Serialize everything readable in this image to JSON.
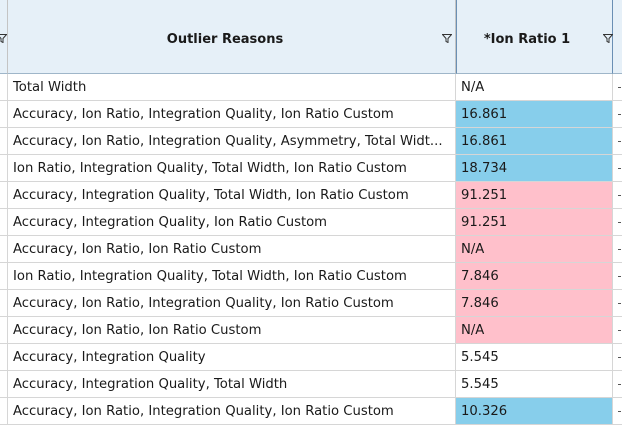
{
  "columns": {
    "outlier_reasons": "Outlier Reasons",
    "ion_ratio_1": "*Ion Ratio 1"
  },
  "colors": {
    "header_bg": "#e6f0f8",
    "blue_highlight": "#87ceeb",
    "pink_highlight": "#ffc0cb",
    "gridline": "#d6d6d6"
  },
  "icons": {
    "filter": "filter-icon"
  },
  "rows": [
    {
      "reason": "Total Width",
      "ion": "N/A",
      "highlight": "none"
    },
    {
      "reason": "Accuracy, Ion Ratio, Integration Quality, Ion Ratio Custom",
      "ion": "16.861",
      "highlight": "blue"
    },
    {
      "reason": "Accuracy, Ion Ratio, Integration Quality, Asymmetry, Total Widt...",
      "ion": "16.861",
      "highlight": "blue"
    },
    {
      "reason": "Ion Ratio, Integration Quality, Total Width, Ion Ratio Custom",
      "ion": "18.734",
      "highlight": "blue"
    },
    {
      "reason": "Accuracy, Integration Quality, Total Width, Ion Ratio Custom",
      "ion": "91.251",
      "highlight": "pink"
    },
    {
      "reason": "Accuracy, Integration Quality, Ion Ratio Custom",
      "ion": "91.251",
      "highlight": "pink"
    },
    {
      "reason": "Accuracy, Ion Ratio, Ion Ratio Custom",
      "ion": "N/A",
      "highlight": "pink"
    },
    {
      "reason": "Ion Ratio, Integration Quality, Total Width, Ion Ratio Custom",
      "ion": "7.846",
      "highlight": "pink"
    },
    {
      "reason": "Accuracy, Ion Ratio, Integration Quality, Ion Ratio Custom",
      "ion": "7.846",
      "highlight": "pink"
    },
    {
      "reason": "Accuracy, Ion Ratio, Ion Ratio Custom",
      "ion": "N/A",
      "highlight": "pink"
    },
    {
      "reason": "Accuracy, Integration Quality",
      "ion": "5.545",
      "highlight": "none"
    },
    {
      "reason": "Accuracy, Integration Quality, Total Width",
      "ion": "5.545",
      "highlight": "none"
    },
    {
      "reason": "Accuracy, Ion Ratio, Integration Quality, Ion Ratio Custom",
      "ion": "10.326",
      "highlight": "blue"
    }
  ]
}
